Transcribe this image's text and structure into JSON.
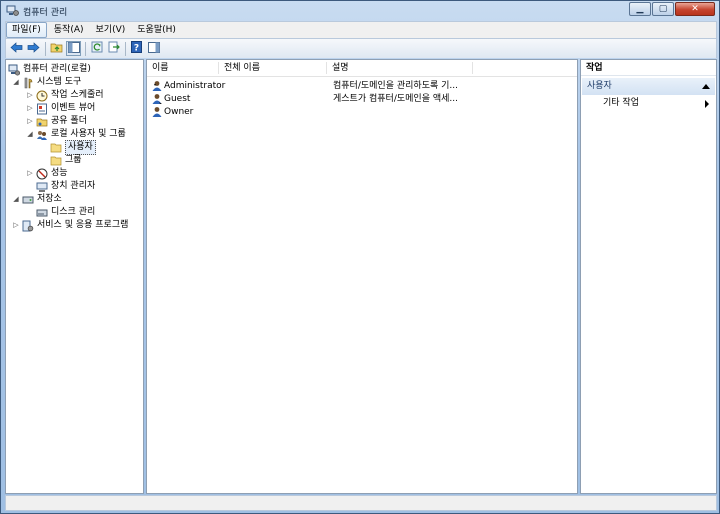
{
  "window": {
    "title": "컴퓨터 관리"
  },
  "menu": [
    "파일(F)",
    "동작(A)",
    "보기(V)",
    "도움말(H)"
  ],
  "toolbar": {
    "icons": [
      "back-arrow-icon",
      "forward-arrow-icon",
      "up-folder-icon",
      "show-hide-tree-icon",
      "refresh-icon",
      "export-list-icon",
      "help-icon",
      "show-hide-action-pane-icon"
    ]
  },
  "tree": {
    "root": "컴퓨터 관리(로컬)",
    "system_tools": "시스템 도구",
    "task_scheduler": "작업 스케줄러",
    "event_viewer": "이벤트 뷰어",
    "shared_folders": "공유 폴더",
    "local_users": "로컬 사용자 및 그룹",
    "users": "사용자",
    "groups": "그룹",
    "performance": "성능",
    "device_manager": "장치 관리자",
    "storage": "저장소",
    "disk_management": "디스크 관리",
    "services_apps": "서비스 및 응용 프로그램"
  },
  "list": {
    "columns": [
      "이름",
      "전체 이름",
      "설명"
    ],
    "rows": [
      {
        "name": "Administrator",
        "full_name": "",
        "description": "컴퓨터/도메인을 관리하도록 기..."
      },
      {
        "name": "Guest",
        "full_name": "",
        "description": "게스트가 컴퓨터/도메인을 액세..."
      },
      {
        "name": "Owner",
        "full_name": "",
        "description": ""
      }
    ]
  },
  "actions": {
    "header": "작업",
    "section": "사용자",
    "items": [
      "기타 작업"
    ]
  }
}
